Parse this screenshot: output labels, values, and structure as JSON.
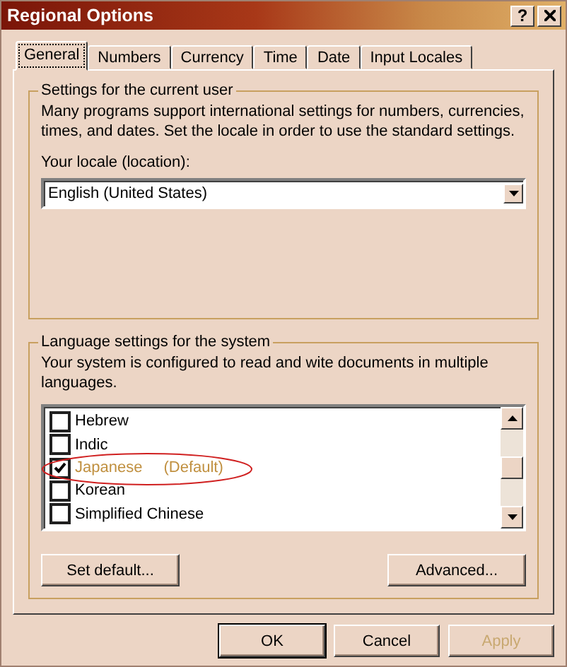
{
  "window": {
    "title": "Regional Options",
    "help": "?"
  },
  "tabs": [
    {
      "label": "General",
      "selected": true
    },
    {
      "label": "Numbers",
      "selected": false
    },
    {
      "label": "Currency",
      "selected": false
    },
    {
      "label": "Time",
      "selected": false
    },
    {
      "label": "Date",
      "selected": false
    },
    {
      "label": "Input Locales",
      "selected": false
    }
  ],
  "user_group": {
    "title": "Settings for the current user",
    "description": "Many programs support international settings for numbers, currencies, times, and dates. Set the locale in order to use the standard settings.",
    "locale_label": "Your locale (location):",
    "locale_value": "English (United States)"
  },
  "system_group": {
    "title": "Language settings for the system",
    "description": "Your system is configured to read and wite documents in multiple languages.",
    "languages": [
      {
        "label": "Hebrew",
        "checked": false,
        "annotated": false
      },
      {
        "label": "Indic",
        "checked": false,
        "annotated": false
      },
      {
        "label": "Japanese",
        "tag": "(Default)",
        "checked": true,
        "annotated": true
      },
      {
        "label": "Korean",
        "checked": false,
        "annotated": false
      },
      {
        "label": "Simplified Chinese",
        "checked": false,
        "annotated": false
      }
    ],
    "buttons": [
      {
        "label": "Set default...",
        "kind": "set_default"
      },
      {
        "label": "Advanced...",
        "kind": "advanced"
      }
    ]
  },
  "dialog_buttons": [
    {
      "label": "OK",
      "disabled": false,
      "default": true
    },
    {
      "label": "Cancel",
      "disabled": false,
      "default": false
    },
    {
      "label": "Apply",
      "disabled": true,
      "default": false
    }
  ]
}
